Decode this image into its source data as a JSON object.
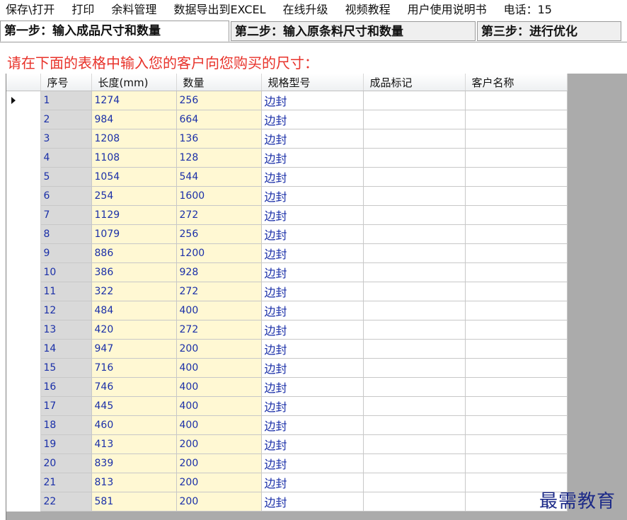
{
  "menu": [
    "保存\\打开",
    "打印",
    "余料管理",
    "数据导出到EXCEL",
    "在线升级",
    "视频教程",
    "用户使用说明书",
    "电话：15"
  ],
  "tabs": [
    "第一步：输入成品尺寸和数量",
    "第二步：输入原条料尺寸和数量",
    "第三步：进行优化"
  ],
  "instruction": "请在下面的表格中输入您的客户向您购买的尺寸：",
  "grid": {
    "columns": [
      "序号",
      "长度(mm)",
      "数量",
      "规格型号",
      "成品标记",
      "客户名称"
    ],
    "rows": [
      {
        "seq": "1",
        "length": "1274",
        "qty": "256",
        "spec": "边封",
        "mark": "",
        "customer": ""
      },
      {
        "seq": "2",
        "length": "984",
        "qty": "664",
        "spec": "边封",
        "mark": "",
        "customer": ""
      },
      {
        "seq": "3",
        "length": "1208",
        "qty": "136",
        "spec": "边封",
        "mark": "",
        "customer": ""
      },
      {
        "seq": "4",
        "length": "1108",
        "qty": "128",
        "spec": "边封",
        "mark": "",
        "customer": ""
      },
      {
        "seq": "5",
        "length": "1054",
        "qty": "544",
        "spec": "边封",
        "mark": "",
        "customer": ""
      },
      {
        "seq": "6",
        "length": "254",
        "qty": "1600",
        "spec": "边封",
        "mark": "",
        "customer": ""
      },
      {
        "seq": "7",
        "length": "1129",
        "qty": "272",
        "spec": "边封",
        "mark": "",
        "customer": ""
      },
      {
        "seq": "8",
        "length": "1079",
        "qty": "256",
        "spec": "边封",
        "mark": "",
        "customer": ""
      },
      {
        "seq": "9",
        "length": "886",
        "qty": "1200",
        "spec": "边封",
        "mark": "",
        "customer": ""
      },
      {
        "seq": "10",
        "length": "386",
        "qty": "928",
        "spec": "边封",
        "mark": "",
        "customer": ""
      },
      {
        "seq": "11",
        "length": "322",
        "qty": "272",
        "spec": "边封",
        "mark": "",
        "customer": ""
      },
      {
        "seq": "12",
        "length": "484",
        "qty": "400",
        "spec": "边封",
        "mark": "",
        "customer": ""
      },
      {
        "seq": "13",
        "length": "420",
        "qty": "272",
        "spec": "边封",
        "mark": "",
        "customer": ""
      },
      {
        "seq": "14",
        "length": "947",
        "qty": "200",
        "spec": "边封",
        "mark": "",
        "customer": ""
      },
      {
        "seq": "15",
        "length": "716",
        "qty": "400",
        "spec": "边封",
        "mark": "",
        "customer": ""
      },
      {
        "seq": "16",
        "length": "746",
        "qty": "400",
        "spec": "边封",
        "mark": "",
        "customer": ""
      },
      {
        "seq": "17",
        "length": "445",
        "qty": "400",
        "spec": "边封",
        "mark": "",
        "customer": ""
      },
      {
        "seq": "18",
        "length": "460",
        "qty": "400",
        "spec": "边封",
        "mark": "",
        "customer": ""
      },
      {
        "seq": "19",
        "length": "413",
        "qty": "200",
        "spec": "边封",
        "mark": "",
        "customer": ""
      },
      {
        "seq": "20",
        "length": "839",
        "qty": "200",
        "spec": "边封",
        "mark": "",
        "customer": ""
      },
      {
        "seq": "21",
        "length": "813",
        "qty": "200",
        "spec": "边封",
        "mark": "",
        "customer": ""
      },
      {
        "seq": "22",
        "length": "581",
        "qty": "200",
        "spec": "边封",
        "mark": "",
        "customer": ""
      }
    ],
    "current_row_icon": "row-pointer-icon"
  },
  "watermark": "最需教育",
  "colors": {
    "instruction": "#e8322a",
    "cell_text": "#1a2fa8",
    "seq_bg": "#d9d9d9",
    "length_qty_bg": "#fff8d3",
    "grid_empty_bg": "#ababab",
    "watermark": "#1c2a88"
  }
}
